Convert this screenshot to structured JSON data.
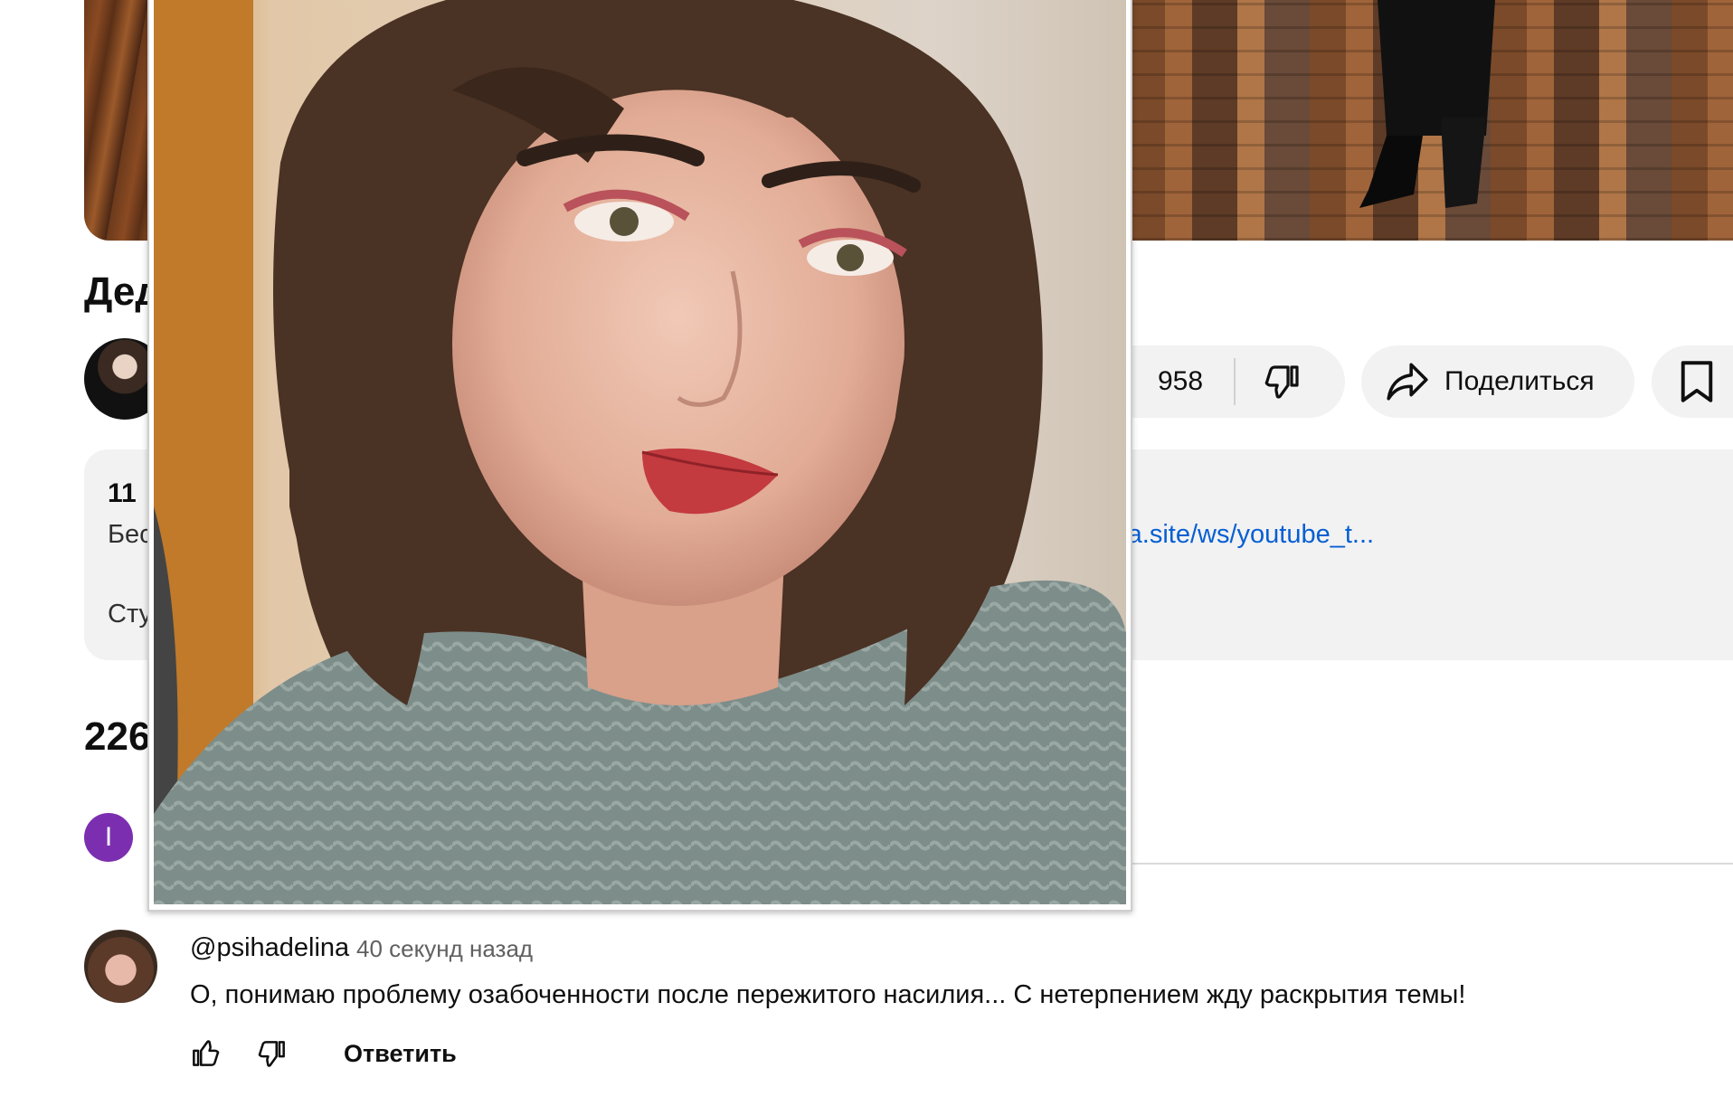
{
  "video": {
    "title_visible": "Дед",
    "likes": "958",
    "share_label": "Поделиться"
  },
  "description": {
    "stats_visible": "11",
    "line1_visible": "Бес",
    "link_visible": "eya.site/ws/youtube_t...",
    "line2_visible": "Сту"
  },
  "comments": {
    "count_visible": "226",
    "current_user_initial": "I",
    "items": [
      {
        "handle": "@psihadelina",
        "time": "40 секунд назад",
        "text": "О, понимаю проблему озабоченности после пережитого насилия... С нетерпением жду раскрытия темы!",
        "reply_label": "Ответить"
      }
    ]
  },
  "icons": [
    "thumb-up-icon",
    "thumb-down-icon",
    "share-icon",
    "save-icon"
  ],
  "colors": {
    "link": "#065fd4",
    "avatar_purple": "#7b2fb0",
    "pill_bg": "#f2f2f2"
  }
}
